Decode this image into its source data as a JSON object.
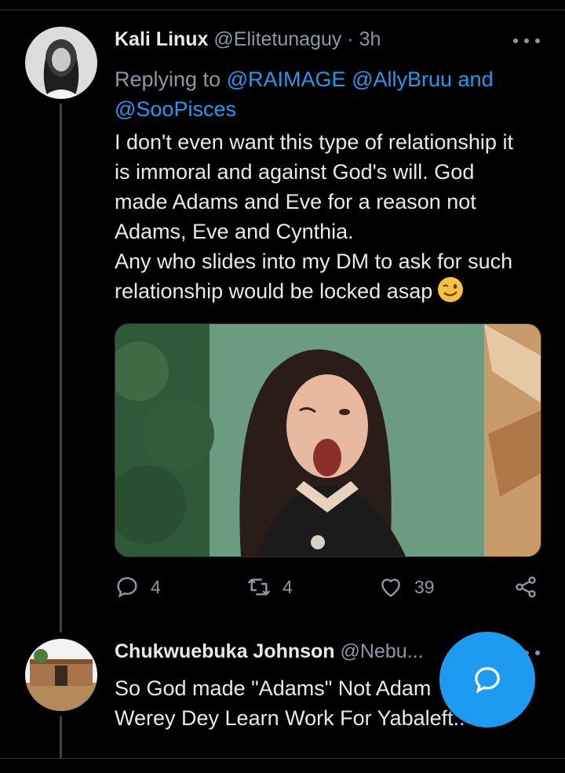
{
  "tweet1": {
    "display_name": "Kali Linux",
    "handle": "@Elitetunaguy",
    "separator": "·",
    "time": "3h",
    "replying_to": {
      "prefix": "Replying to",
      "mention1": "@RAIMAGE",
      "mention2": "@AllyBruu",
      "conjunction": "and",
      "mention3": "@SooPisces"
    },
    "lines": [
      "I don't  even want this type of relationship it",
      "is immoral  and against  God's will. God",
      "made  Adams and Eve for a reason  not",
      "Adams, Eve and Cynthia.",
      "Any who slides into my DM to ask for such",
      "relationship  would be locked asap"
    ],
    "emoji": "winking-face",
    "stats": {
      "replies": "4",
      "retweets": "4",
      "likes": "39"
    }
  },
  "tweet2": {
    "display_name": "Chukwuebuka Johnson",
    "handle": "@Nebu...",
    "lines": [
      "So God made \"Adams\" Not Adam",
      "Werey Dey Learn Work For Yabaleft.."
    ]
  },
  "icons": [
    "more-icon",
    "reply-icon",
    "retweet-icon",
    "like-icon",
    "share-icon",
    "compose-icon"
  ],
  "colors": {
    "background": "#000000",
    "accent": "#1d9bf0",
    "text": "#e7e9ea",
    "muted": "#8b98a5"
  }
}
